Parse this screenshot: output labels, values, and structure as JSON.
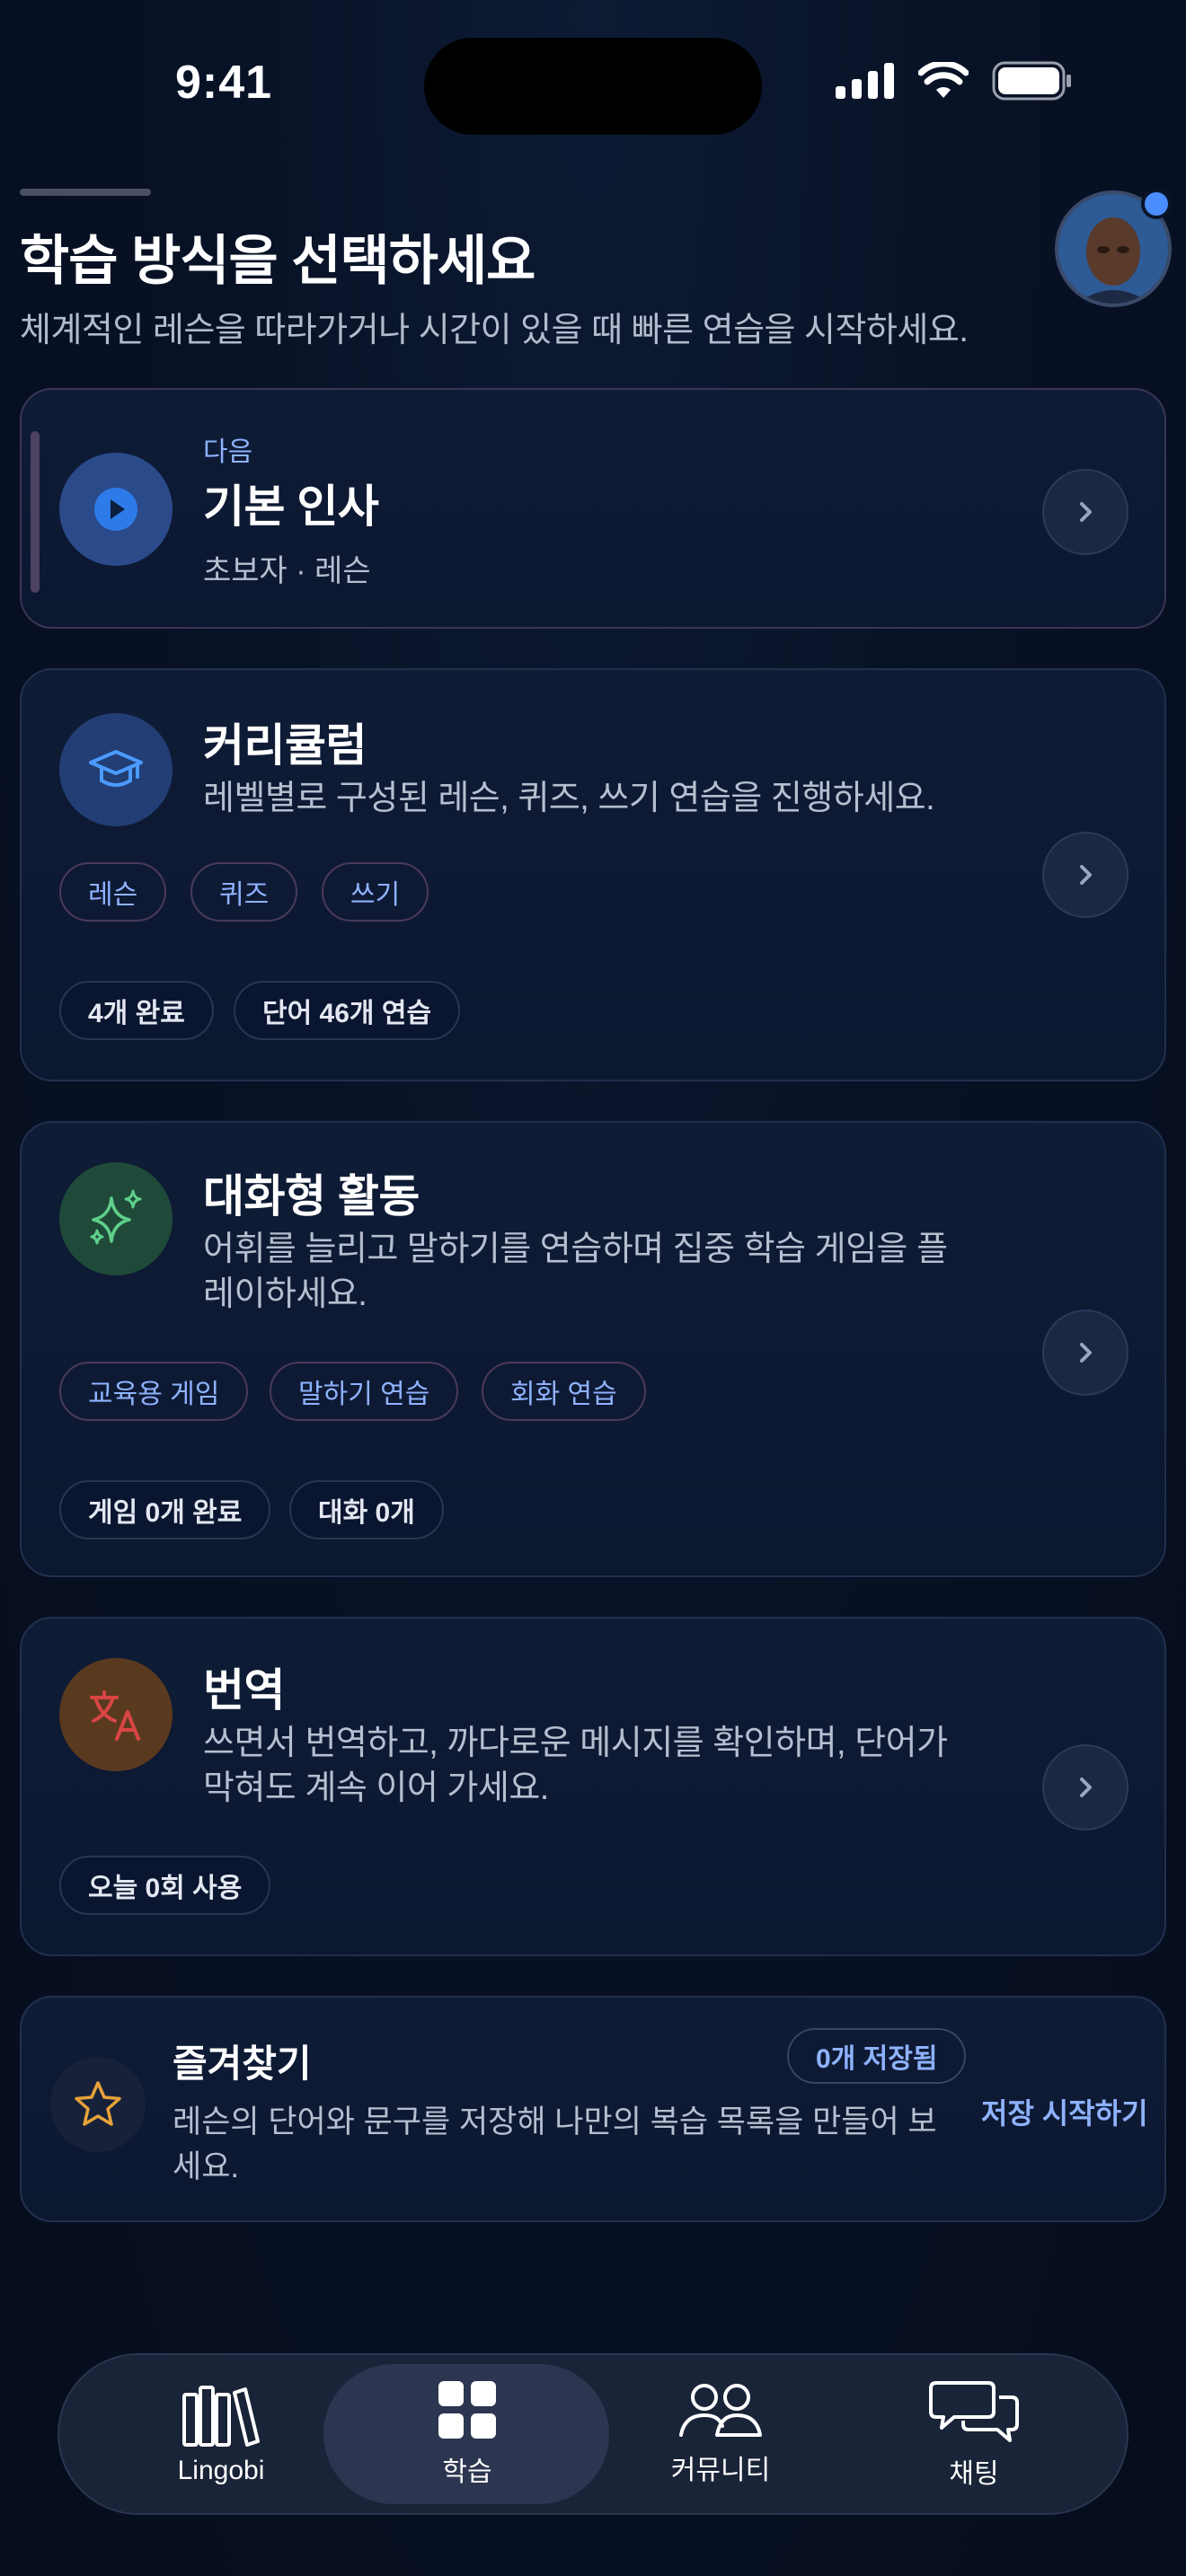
{
  "status_bar": {
    "time": "9:41"
  },
  "header": {
    "title": "학습 방식을 선택하세요",
    "subtitle": "체계적인 레슨을 따라가거나 시간이 있을 때 빠른 연습을 시작하세요."
  },
  "next_card": {
    "label": "다음",
    "title": "기본 인사",
    "meta": "초보자 · 레슨",
    "icon": "play-icon"
  },
  "curriculum": {
    "title": "커리큘럼",
    "desc": "레벨별로 구성된 레슨, 퀴즈, 쓰기 연습을 진행하세요.",
    "chips": [
      "레슨",
      "퀴즈",
      "쓰기"
    ],
    "stats": [
      "4개 완료",
      "단어 46개 연습"
    ],
    "icon": "graduation-cap-icon"
  },
  "activities": {
    "title": "대화형 활동",
    "desc_line1": "어휘를 늘리고 말하기를 연습하며 집중 학습 게임을 플",
    "desc_line2": "레이하세요.",
    "chips": [
      "교육용 게임",
      "말하기 연습",
      "회화 연습"
    ],
    "stats": [
      "게임 0개 완료",
      "대화 0개"
    ],
    "icon": "sparkles-icon"
  },
  "translation": {
    "title": "번역",
    "desc_line1": "쓰면서 번역하고, 까다로운 메시지를 확인하며, 단어가",
    "desc_line2": "막혀도 계속 이어 가세요.",
    "stats": [
      "오늘 0회 사용"
    ],
    "icon": "translate-icon"
  },
  "favorites": {
    "title": "즐겨찾기",
    "badge": "0개 저장됨",
    "desc_line1": "레슨의 단어와 문구를 저장해 나만의 복습 목록을 만들어 보",
    "desc_line2": "세요.",
    "action": "저장 시작하기",
    "icon": "star-icon"
  },
  "tabs": [
    {
      "label": "Lingobi",
      "icon": "library-icon"
    },
    {
      "label": "학습",
      "icon": "grid-icon",
      "active": true
    },
    {
      "label": "커뮤니티",
      "icon": "people-icon"
    },
    {
      "label": "채팅",
      "icon": "chat-bubbles-icon"
    }
  ],
  "colors": {
    "background": "#081226",
    "accent_blue": "#8fb2ff",
    "card": "#0f1c36",
    "star": "#e8a23a",
    "translate_red": "#d94545",
    "sparkle_green": "#5fd08a"
  }
}
